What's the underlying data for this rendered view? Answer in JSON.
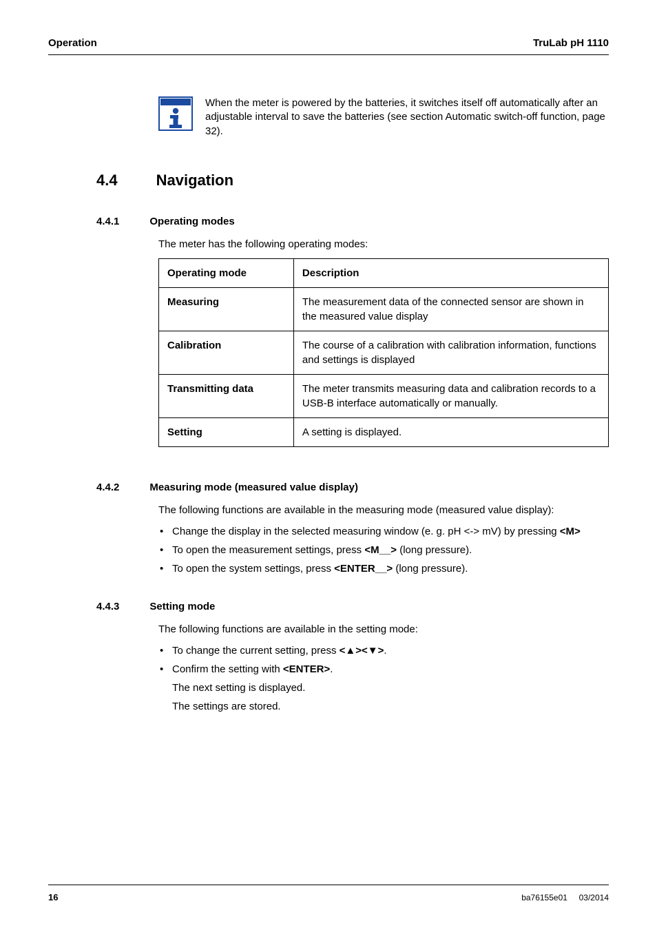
{
  "header": {
    "left": "Operation",
    "right": "TruLab pH 1110"
  },
  "infoNote": "When the meter is powered by the batteries, it switches itself off automatically after an adjustable interval to save the batteries (see section  Automatic switch-off function, page 32).",
  "section": {
    "number": "4.4",
    "title": "Navigation"
  },
  "sub1": {
    "number": "4.4.1",
    "title": "Operating modes",
    "intro": "The meter has the following operating modes:",
    "table": {
      "head": [
        "Operating mode",
        "Description"
      ],
      "rows": [
        [
          "Measuring",
          "The measurement data of the connected sensor are shown in the measured value display"
        ],
        [
          "Calibration",
          "The course of a calibration with calibration information, functions and settings is displayed"
        ],
        [
          "Transmitting data",
          "The meter transmits measuring data and calibration records to a USB-B interface automatically or manually."
        ],
        [
          "Setting",
          "A setting is displayed."
        ]
      ]
    }
  },
  "sub2": {
    "number": "4.4.2",
    "title": "Measuring mode (measured value display)",
    "intro": "The following functions are available in the measuring mode (measured value display):",
    "bullets": [
      {
        "pre": "Change the display in the selected measuring window (e. g. pH <-> mV) by pressing ",
        "key": "<M>"
      },
      {
        "pre": "To open the measurement settings, press ",
        "key": "<M__>",
        "post": " (long pressure)."
      },
      {
        "pre": "To open the system settings, press ",
        "key": "<ENTER__>",
        "post": " (long pressure)."
      }
    ]
  },
  "sub3": {
    "number": "4.4.3",
    "title": "Setting mode",
    "intro": "The following functions are available in the setting mode:",
    "bullets": [
      {
        "pre": "To change the current setting, press ",
        "key": "<▲><▼>",
        "post": "."
      },
      {
        "pre": "Confirm the setting with ",
        "key": "<ENTER>",
        "post": ".",
        "sublines": [
          "The next setting is displayed.",
          "The settings are stored."
        ]
      }
    ]
  },
  "footer": {
    "page": "16",
    "doc": "ba76155e01",
    "date": "03/2014"
  }
}
